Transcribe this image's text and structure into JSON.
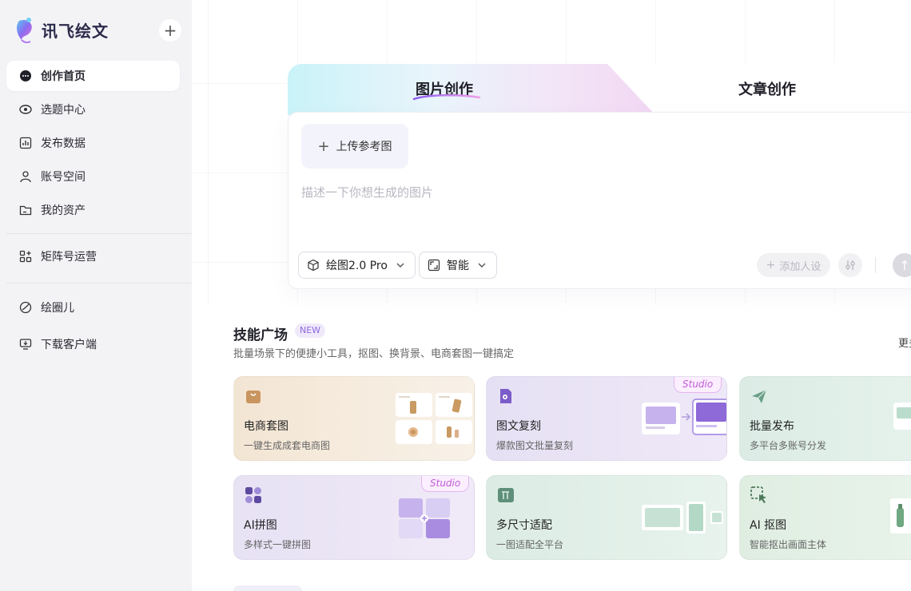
{
  "brand": {
    "name": "讯飞绘文"
  },
  "sidebar": {
    "items": [
      {
        "label": "创作首页",
        "icon": "chat-bubble-icon",
        "active": true
      },
      {
        "label": "选题中心",
        "icon": "eye-target-icon"
      },
      {
        "label": "发布数据",
        "icon": "bar-chart-icon"
      },
      {
        "label": "账号空间",
        "icon": "user-icon"
      },
      {
        "label": "我的资产",
        "icon": "folder-icon"
      }
    ],
    "items2": [
      {
        "label": "矩阵号运营",
        "icon": "grid-plus-icon"
      }
    ],
    "items3": [
      {
        "label": "绘圈儿",
        "icon": "circle-leaf-icon"
      },
      {
        "label": "下载客户端",
        "icon": "monitor-download-icon"
      }
    ]
  },
  "creator": {
    "tabs": {
      "image": "图片创作",
      "article": "文章创作"
    },
    "upload_label": "上传参考图",
    "prompt_placeholder": "描述一下你想生成的图片",
    "model_label": "绘图2.0 Pro",
    "ratio_label": "智能",
    "persona_label": "添加人设"
  },
  "skills": {
    "title": "技能广场",
    "badge": "NEW",
    "subtitle": "批量场景下的便捷小工具，抠图、换背景、电商套图一键搞定",
    "more": "更多",
    "studio_tag": "Studio",
    "cards": [
      {
        "title": "电商套图",
        "desc": "一键生成成套电商图"
      },
      {
        "title": "图文复刻",
        "desc": "爆款图文批量复刻"
      },
      {
        "title": "批量发布",
        "desc": "多平台多账号分发"
      },
      {
        "title": "AI拼图",
        "desc": "多样式一键拼图"
      },
      {
        "title": "多尺寸适配",
        "desc": "一图适配全平台"
      },
      {
        "title": "AI 抠图",
        "desc": "智能抠出画面主体"
      }
    ]
  },
  "colors": {
    "accent": "#8f68e0",
    "studio": "#c25ad6",
    "sidebar_bg": "#f3f3f6"
  }
}
